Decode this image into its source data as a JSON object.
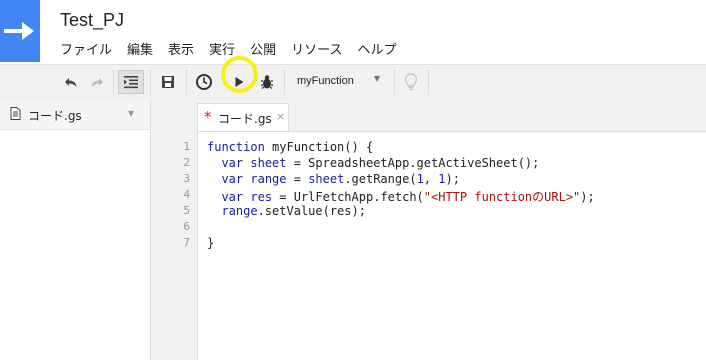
{
  "header": {
    "project_title": "Test_PJ",
    "menu": [
      "ファイル",
      "編集",
      "表示",
      "実行",
      "公開",
      "リソース",
      "ヘルプ"
    ]
  },
  "toolbar": {
    "function_select": "myFunction",
    "icons": [
      "undo-icon",
      "redo-icon",
      "indent-icon",
      "save-icon",
      "clock-icon",
      "run-icon",
      "bug-icon",
      "lightbulb-icon"
    ]
  },
  "sidebar": {
    "file_name": "コード.gs"
  },
  "editor": {
    "tab_modified_marker": "*",
    "tab_label": "コード.gs",
    "tab_close": "×",
    "line_numbers": [
      "1",
      "2",
      "3",
      "4",
      "5",
      "6",
      "7"
    ],
    "code": {
      "l1_kw": "function",
      "l1_rest": " myFunction() {",
      "l2_kw": "var",
      "l2_var": "sheet",
      "l2_rest": " = SpreadsheetApp.getActiveSheet();",
      "l3_kw": "var",
      "l3_var": "range",
      "l3_mid": " = ",
      "l3_var2": "sheet",
      "l3_rest1": ".getRange(",
      "l3_num1": "1",
      "l3_comma": ", ",
      "l3_num2": "1",
      "l3_end": ");",
      "l4_kw": "var",
      "l4_var": "res",
      "l4_rest": " = UrlFetchApp.fetch(",
      "l4_str": "\"<HTTP functionのURL>\"",
      "l4_end": ");",
      "l5_var": "range",
      "l5_rest": ".setValue(res);",
      "l7": "}"
    }
  },
  "colors": {
    "brand_blue": "#4285f4",
    "highlight_yellow": "#f7ee1e",
    "modified_red": "#d21e1e"
  }
}
